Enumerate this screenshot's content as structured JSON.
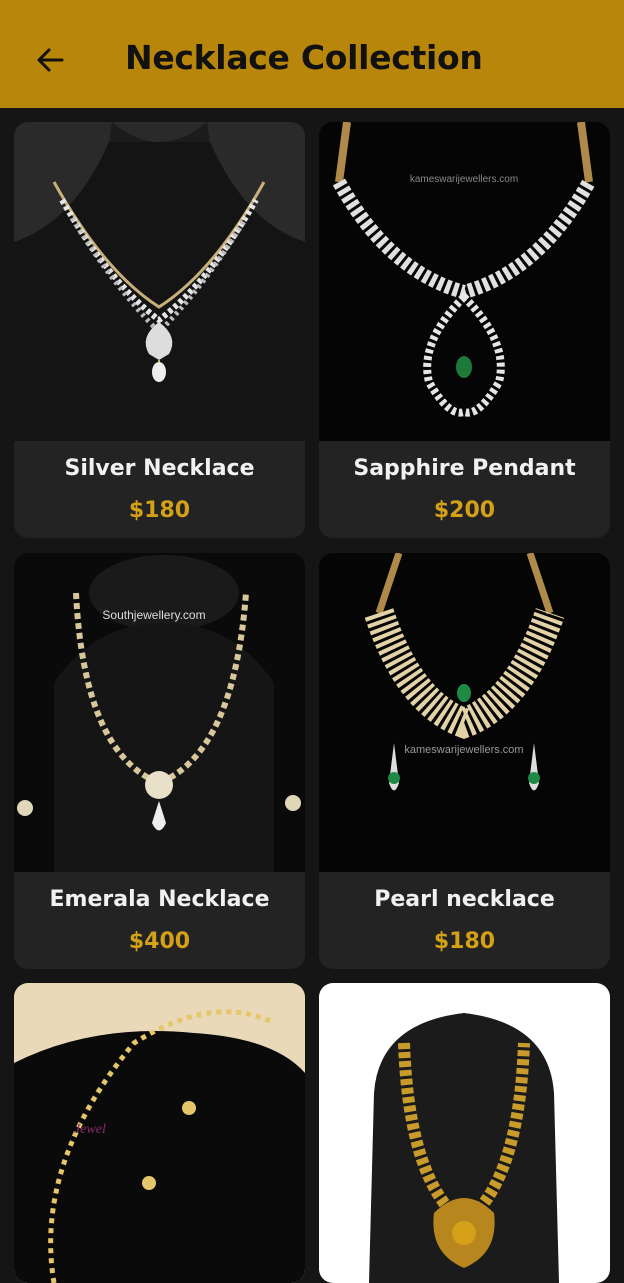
{
  "appbar": {
    "title": "Necklace Collection",
    "back_icon": "arrow-left-icon",
    "background": "#b8860b"
  },
  "products": [
    {
      "name": "Silver Necklace",
      "price": "$180"
    },
    {
      "name": "Sapphire Pendant",
      "price": "$200",
      "watermark": "kameswarijewellers.com"
    },
    {
      "name": "Emerala Necklace",
      "price": "$400",
      "watermark": "Southjewellery.com"
    },
    {
      "name": "Pearl necklace",
      "price": "$180",
      "watermark": "kameswarijewellers.com"
    },
    {
      "name": "",
      "price": ""
    },
    {
      "name": "",
      "price": ""
    }
  ],
  "colors": {
    "background": "#151515",
    "card": "#232323",
    "price": "#d4a017",
    "name": "#f1f1f1"
  }
}
